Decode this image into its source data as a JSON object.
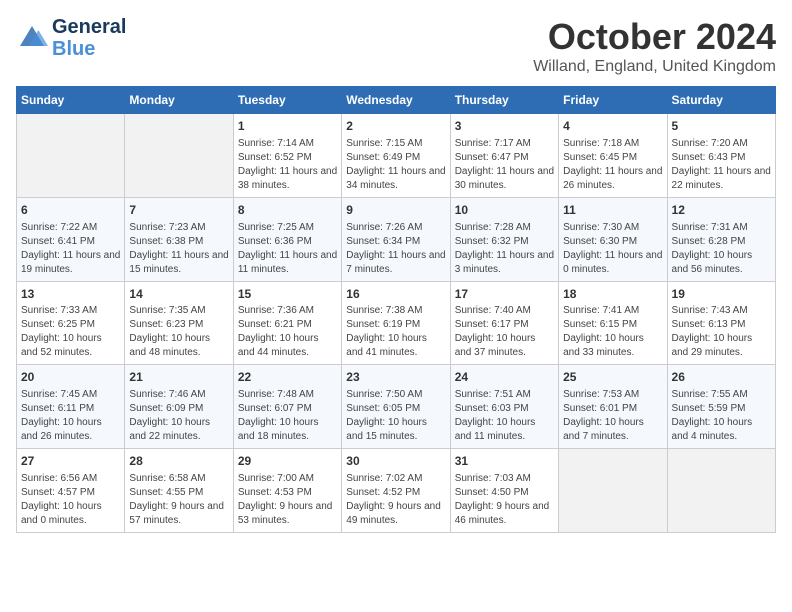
{
  "header": {
    "logo_line1": "General",
    "logo_line2": "Blue",
    "month": "October 2024",
    "location": "Willand, England, United Kingdom"
  },
  "days_of_week": [
    "Sunday",
    "Monday",
    "Tuesday",
    "Wednesday",
    "Thursday",
    "Friday",
    "Saturday"
  ],
  "weeks": [
    [
      {
        "day": null,
        "data": null
      },
      {
        "day": null,
        "data": null
      },
      {
        "day": "1",
        "data": "Sunrise: 7:14 AM\nSunset: 6:52 PM\nDaylight: 11 hours and 38 minutes."
      },
      {
        "day": "2",
        "data": "Sunrise: 7:15 AM\nSunset: 6:49 PM\nDaylight: 11 hours and 34 minutes."
      },
      {
        "day": "3",
        "data": "Sunrise: 7:17 AM\nSunset: 6:47 PM\nDaylight: 11 hours and 30 minutes."
      },
      {
        "day": "4",
        "data": "Sunrise: 7:18 AM\nSunset: 6:45 PM\nDaylight: 11 hours and 26 minutes."
      },
      {
        "day": "5",
        "data": "Sunrise: 7:20 AM\nSunset: 6:43 PM\nDaylight: 11 hours and 22 minutes."
      }
    ],
    [
      {
        "day": "6",
        "data": "Sunrise: 7:22 AM\nSunset: 6:41 PM\nDaylight: 11 hours and 19 minutes."
      },
      {
        "day": "7",
        "data": "Sunrise: 7:23 AM\nSunset: 6:38 PM\nDaylight: 11 hours and 15 minutes."
      },
      {
        "day": "8",
        "data": "Sunrise: 7:25 AM\nSunset: 6:36 PM\nDaylight: 11 hours and 11 minutes."
      },
      {
        "day": "9",
        "data": "Sunrise: 7:26 AM\nSunset: 6:34 PM\nDaylight: 11 hours and 7 minutes."
      },
      {
        "day": "10",
        "data": "Sunrise: 7:28 AM\nSunset: 6:32 PM\nDaylight: 11 hours and 3 minutes."
      },
      {
        "day": "11",
        "data": "Sunrise: 7:30 AM\nSunset: 6:30 PM\nDaylight: 11 hours and 0 minutes."
      },
      {
        "day": "12",
        "data": "Sunrise: 7:31 AM\nSunset: 6:28 PM\nDaylight: 10 hours and 56 minutes."
      }
    ],
    [
      {
        "day": "13",
        "data": "Sunrise: 7:33 AM\nSunset: 6:25 PM\nDaylight: 10 hours and 52 minutes."
      },
      {
        "day": "14",
        "data": "Sunrise: 7:35 AM\nSunset: 6:23 PM\nDaylight: 10 hours and 48 minutes."
      },
      {
        "day": "15",
        "data": "Sunrise: 7:36 AM\nSunset: 6:21 PM\nDaylight: 10 hours and 44 minutes."
      },
      {
        "day": "16",
        "data": "Sunrise: 7:38 AM\nSunset: 6:19 PM\nDaylight: 10 hours and 41 minutes."
      },
      {
        "day": "17",
        "data": "Sunrise: 7:40 AM\nSunset: 6:17 PM\nDaylight: 10 hours and 37 minutes."
      },
      {
        "day": "18",
        "data": "Sunrise: 7:41 AM\nSunset: 6:15 PM\nDaylight: 10 hours and 33 minutes."
      },
      {
        "day": "19",
        "data": "Sunrise: 7:43 AM\nSunset: 6:13 PM\nDaylight: 10 hours and 29 minutes."
      }
    ],
    [
      {
        "day": "20",
        "data": "Sunrise: 7:45 AM\nSunset: 6:11 PM\nDaylight: 10 hours and 26 minutes."
      },
      {
        "day": "21",
        "data": "Sunrise: 7:46 AM\nSunset: 6:09 PM\nDaylight: 10 hours and 22 minutes."
      },
      {
        "day": "22",
        "data": "Sunrise: 7:48 AM\nSunset: 6:07 PM\nDaylight: 10 hours and 18 minutes."
      },
      {
        "day": "23",
        "data": "Sunrise: 7:50 AM\nSunset: 6:05 PM\nDaylight: 10 hours and 15 minutes."
      },
      {
        "day": "24",
        "data": "Sunrise: 7:51 AM\nSunset: 6:03 PM\nDaylight: 10 hours and 11 minutes."
      },
      {
        "day": "25",
        "data": "Sunrise: 7:53 AM\nSunset: 6:01 PM\nDaylight: 10 hours and 7 minutes."
      },
      {
        "day": "26",
        "data": "Sunrise: 7:55 AM\nSunset: 5:59 PM\nDaylight: 10 hours and 4 minutes."
      }
    ],
    [
      {
        "day": "27",
        "data": "Sunrise: 6:56 AM\nSunset: 4:57 PM\nDaylight: 10 hours and 0 minutes."
      },
      {
        "day": "28",
        "data": "Sunrise: 6:58 AM\nSunset: 4:55 PM\nDaylight: 9 hours and 57 minutes."
      },
      {
        "day": "29",
        "data": "Sunrise: 7:00 AM\nSunset: 4:53 PM\nDaylight: 9 hours and 53 minutes."
      },
      {
        "day": "30",
        "data": "Sunrise: 7:02 AM\nSunset: 4:52 PM\nDaylight: 9 hours and 49 minutes."
      },
      {
        "day": "31",
        "data": "Sunrise: 7:03 AM\nSunset: 4:50 PM\nDaylight: 9 hours and 46 minutes."
      },
      {
        "day": null,
        "data": null
      },
      {
        "day": null,
        "data": null
      }
    ]
  ]
}
